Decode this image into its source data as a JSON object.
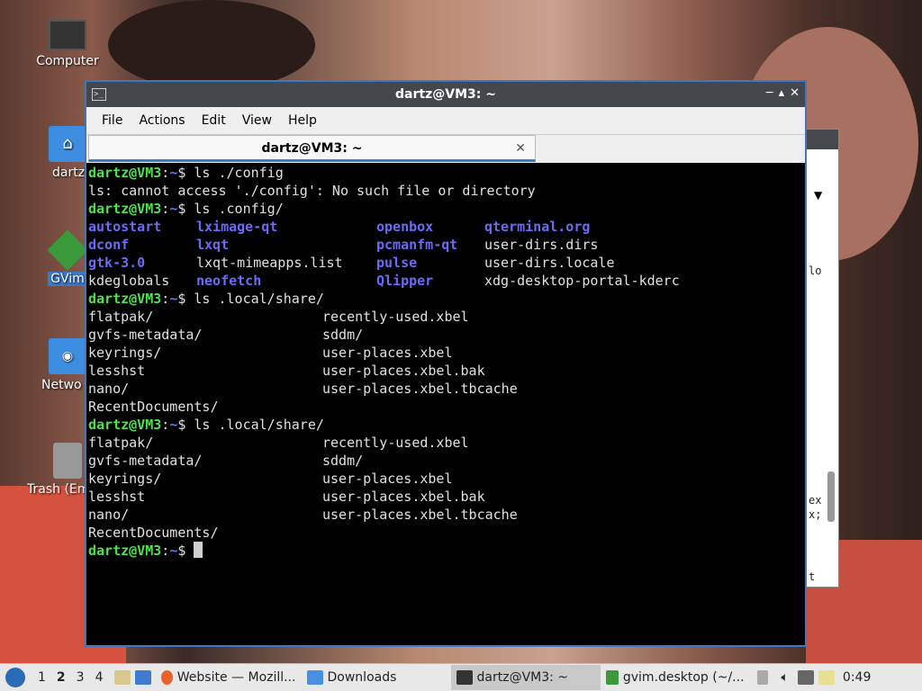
{
  "desktop": {
    "icons": [
      {
        "name": "computer",
        "label": "Computer"
      },
      {
        "name": "home",
        "label": "dartz"
      },
      {
        "name": "gvim",
        "label": "GVim"
      },
      {
        "name": "network",
        "label": "Netwo"
      },
      {
        "name": "trash",
        "label": "Trash (Em"
      }
    ]
  },
  "background_window": {
    "lines": [
      "lo",
      "ex",
      "x;",
      "t"
    ]
  },
  "window": {
    "title": "dartz@VM3: ~",
    "menu": [
      "File",
      "Actions",
      "Edit",
      "View",
      "Help"
    ],
    "tab_label": "dartz@VM3: ~",
    "tab_close": "✕",
    "buttons": {
      "minimize": "─",
      "maximize": "▴",
      "close": "✕"
    }
  },
  "terminal": {
    "prompt_user": "dartz@VM3",
    "prompt_sep": ":",
    "prompt_path": "~",
    "prompt_end": "$ ",
    "cmd1": "ls ./config",
    "err1": "ls: cannot access './config': No such file or directory",
    "cmd2": "ls .config/",
    "config_rows": [
      [
        {
          "t": "autostart",
          "d": true
        },
        {
          "t": "lximage-qt",
          "d": true
        },
        {
          "t": "openbox",
          "d": true
        },
        {
          "t": "qterminal.org",
          "d": true
        }
      ],
      [
        {
          "t": "dconf",
          "d": true
        },
        {
          "t": "lxqt",
          "d": true
        },
        {
          "t": "pcmanfm-qt",
          "d": true
        },
        {
          "t": "user-dirs.dirs",
          "d": false
        }
      ],
      [
        {
          "t": "gtk-3.0",
          "d": true
        },
        {
          "t": "lxqt-mimeapps.list",
          "d": false
        },
        {
          "t": "pulse",
          "d": true
        },
        {
          "t": "user-dirs.locale",
          "d": false
        }
      ],
      [
        {
          "t": "kdeglobals",
          "d": false
        },
        {
          "t": "neofetch",
          "d": true
        },
        {
          "t": "Qlipper",
          "d": true
        },
        {
          "t": "xdg-desktop-portal-kderc",
          "d": false
        }
      ]
    ],
    "cmd3": "ls .local/share/",
    "share_rows": [
      [
        "flatpak/",
        "recently-used.xbel"
      ],
      [
        "gvfs-metadata/",
        "sddm/"
      ],
      [
        "keyrings/",
        "user-places.xbel"
      ],
      [
        "lesshst",
        "user-places.xbel.bak"
      ],
      [
        "nano/",
        "user-places.xbel.tbcache"
      ],
      [
        "RecentDocuments/",
        ""
      ]
    ]
  },
  "taskbar": {
    "workspaces": [
      "1",
      "2",
      "3",
      "4"
    ],
    "active_workspace": "2",
    "tasks": [
      {
        "name": "firefox",
        "label": "Website — Mozill..."
      },
      {
        "name": "downloads",
        "label": "Downloads"
      },
      {
        "name": "terminal",
        "label": "dartz@VM3: ~"
      },
      {
        "name": "gvim",
        "label": "gvim.desktop (~/..."
      }
    ],
    "clock": "0:49"
  }
}
